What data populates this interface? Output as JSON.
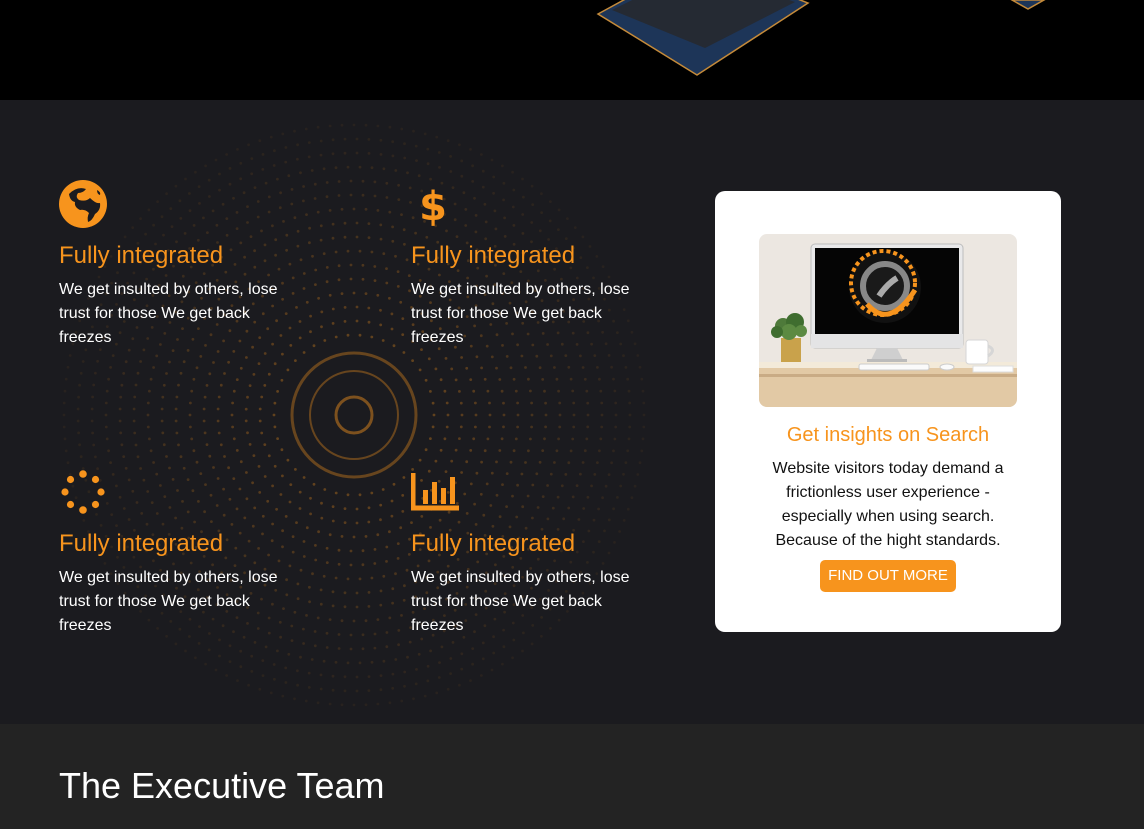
{
  "colors": {
    "accent": "#f7941d",
    "section_bg": "#1b1b1f",
    "team_bg": "#232323",
    "card_bg": "#ffffff"
  },
  "features": [
    {
      "icon": "globe-icon",
      "title": "Fully integrated",
      "description": "We get insulted by others, lose trust for those We get back freezes"
    },
    {
      "icon": "dollar-icon",
      "title": "Fully integrated",
      "description": "We get insulted by others, lose trust for those We get back freezes"
    },
    {
      "icon": "loading-dots-icon",
      "title": "Fully integrated",
      "description": "We get insulted by others, lose trust for those We get back freezes"
    },
    {
      "icon": "bar-chart-icon",
      "title": "Fully integrated",
      "description": "We get insulted by others, lose trust for those We get back freezes"
    }
  ],
  "promo_card": {
    "image": "desk-computer-photo",
    "title": "Get insights on Search",
    "description": "Website visitors today demand a frictionless user experience - especially when using search. Because of the hight standards.",
    "button_label": "FIND OUT MORE"
  },
  "team": {
    "heading": "The Executive Team"
  }
}
